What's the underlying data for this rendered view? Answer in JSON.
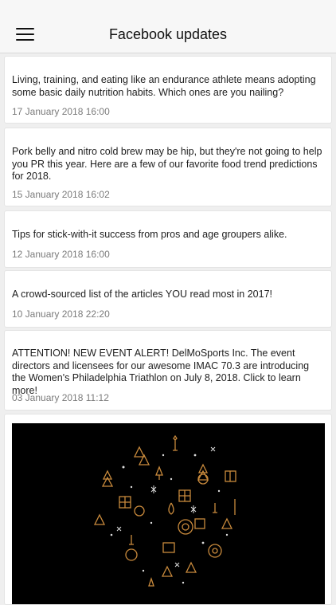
{
  "header": {
    "title": "Facebook updates",
    "menu_icon": "hamburger-menu-icon"
  },
  "posts": [
    {
      "text": "Living, training, and eating like an endurance athlete means adopting some basic daily nutrition habits. Which ones are you nailing?",
      "date": "17 January 2018 16:00"
    },
    {
      "text": "Pork belly and nitro cold brew may be hip, but they're not going to help you PR this year. Here are a few of our favorite food trend predictions for 2018.",
      "date": "15 January 2018 16:02"
    },
    {
      "text": "Tips for stick-with-it success from pros and age groupers alike.",
      "date": "12 January 2018 16:00"
    },
    {
      "text": "A crowd-sourced list of the articles YOU read most in 2017!",
      "date": "10 January 2018 22:20"
    },
    {
      "text": "ATTENTION! NEW EVENT ALERT! DelMoSports Inc.  The event directors and licensees for our awesome IMAC 70.3 are introducing the Women's Philadelphia Triathlon on July 8, 2018. Click to learn more!",
      "date": "03 January 2018 11:12"
    }
  ],
  "image_post": {
    "image_description_icon": "holiday-ornament-circle-image"
  },
  "colors": {
    "background": "#efefef",
    "card": "#ffffff",
    "date_text": "#7b7b7b",
    "gold": "#c98a3c"
  }
}
